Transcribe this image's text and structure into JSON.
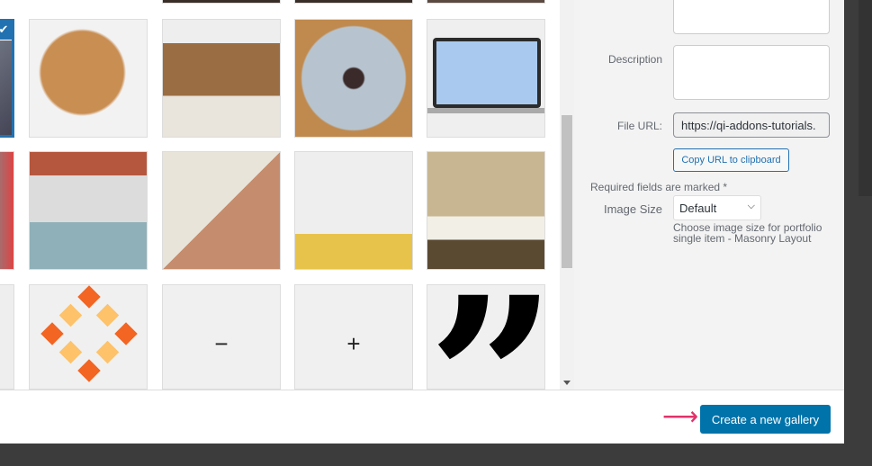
{
  "sidebar": {
    "description_label": "Description",
    "file_url_label": "File URL:",
    "file_url_value": "https://qi-addons-tutorials.",
    "copy_url_label": "Copy URL to clipboard",
    "required_note": "Required fields are marked *",
    "image_size_label": "Image Size",
    "image_size_value": "Default",
    "image_size_help": "Choose image size for portfolio single item - Masonry Layout"
  },
  "grid": {
    "minus_glyph": "−",
    "plus_glyph": "+",
    "quote_glyph": "”",
    "check_glyph": "✔"
  },
  "footer": {
    "create_gallery_label": "Create a new gallery",
    "arrow_glyph": "⟶"
  },
  "colors": {
    "primary": "#0073aa",
    "arrow": "#e0336b"
  }
}
